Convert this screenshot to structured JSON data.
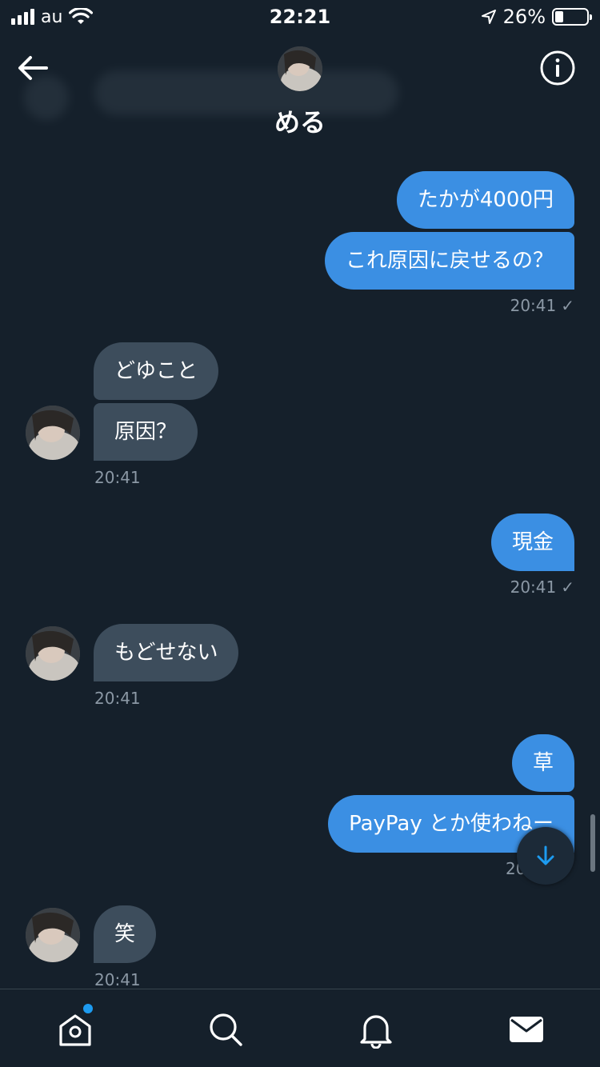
{
  "status_bar": {
    "carrier": "au",
    "time": "22:21",
    "battery": "26%",
    "battery_level": 0.26
  },
  "header": {
    "name": "める"
  },
  "messages": [
    {
      "side": "me",
      "text": "たかが4000円"
    },
    {
      "side": "me",
      "text": "これ原因に戻せるの？",
      "time": "20:41",
      "status": "✓"
    },
    {
      "side": "them",
      "text": "どゆこと"
    },
    {
      "side": "them",
      "text": "原因？",
      "time": "20:41"
    },
    {
      "side": "me",
      "text": "現金",
      "time": "20:41",
      "status": "✓"
    },
    {
      "side": "them",
      "text": "もどせない",
      "time": "20:41"
    },
    {
      "side": "me",
      "text": "草"
    },
    {
      "side": "me",
      "text": "PayPay とか使わねー",
      "time": "20",
      "status": ""
    },
    {
      "side": "them",
      "text": "笑",
      "time": "20:41"
    }
  ],
  "tabs": [
    {
      "name": "home",
      "icon": "home-icon",
      "notification": true
    },
    {
      "name": "search",
      "icon": "search-icon"
    },
    {
      "name": "notifications",
      "icon": "bell-icon"
    },
    {
      "name": "messages",
      "icon": "mail-icon",
      "active": true
    }
  ],
  "colors": {
    "background": "#15202b",
    "my_bubble": "#3b8fe3",
    "their_bubble": "#3d4d5c",
    "timestamp": "#8b98a5",
    "accent": "#1d9bf0"
  }
}
